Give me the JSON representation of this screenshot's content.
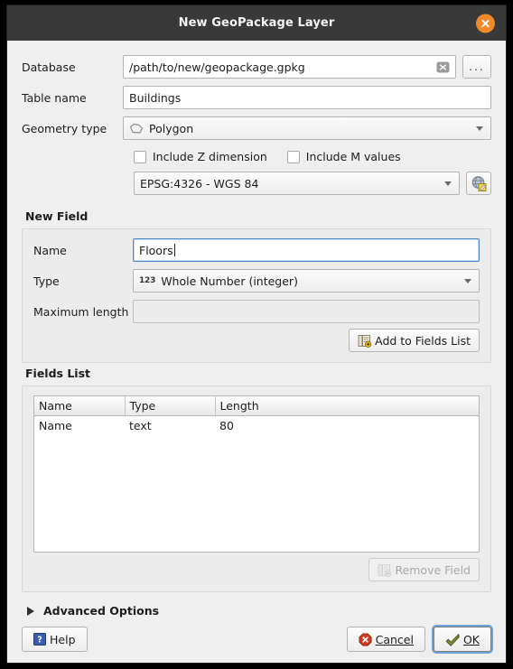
{
  "window": {
    "title": "New GeoPackage Layer",
    "close_icon": "close-circle-icon"
  },
  "form": {
    "database": {
      "label": "Database",
      "value": "/path/to/new/geopackage.gpkg",
      "clear_icon": "clear-icon",
      "browse_label": "...",
      "browse_icon": "ellipsis-icon"
    },
    "table_name": {
      "label": "Table name",
      "value": "Buildings",
      "placeholder": ""
    },
    "geometry_type": {
      "label": "Geometry type",
      "value": "Polygon",
      "icon": "polygon-icon"
    },
    "include_z": {
      "label": "Include Z dimension",
      "checked": false
    },
    "include_m": {
      "label": "Include M values",
      "checked": false
    },
    "crs": {
      "value": "EPSG:4326 - WGS 84",
      "select_button_icon": "globe-edit-icon"
    }
  },
  "new_field": {
    "title": "New Field",
    "name": {
      "label": "Name",
      "value": "Floors",
      "focused": true
    },
    "type": {
      "label": "Type",
      "value": "Whole Number (integer)",
      "icon": "number-123-icon"
    },
    "maximum_length": {
      "label": "Maximum length",
      "value": "",
      "enabled": false
    },
    "add_button": {
      "label": "Add to Fields List",
      "icon": "add-field-icon",
      "enabled": true
    }
  },
  "fields_list": {
    "title": "Fields List",
    "columns": [
      "Name",
      "Type",
      "Length"
    ],
    "rows": [
      {
        "name": "Name",
        "type": "text",
        "length": "80"
      }
    ],
    "remove_button": {
      "label": "Remove Field",
      "icon": "remove-field-icon",
      "enabled": false
    }
  },
  "advanced_options": {
    "label": "Advanced Options",
    "expanded": false,
    "icon": "triangle-right-icon"
  },
  "buttons": {
    "help": {
      "label": "Help",
      "icon": "help-icon"
    },
    "cancel": {
      "label": "Cancel",
      "icon": "cancel-icon"
    },
    "ok": {
      "label": "OK",
      "icon": "ok-icon",
      "is_default": true
    }
  },
  "colors": {
    "titlebar": "#393939",
    "close_button": "#f0892a",
    "dialog_background": "#efefef",
    "group_background": "#ececec",
    "focus_blue": "#4d86c4",
    "cancel_red": "#c0392b",
    "ok_green": "#7a8b3c",
    "help_blue": "#3b5bb5"
  }
}
